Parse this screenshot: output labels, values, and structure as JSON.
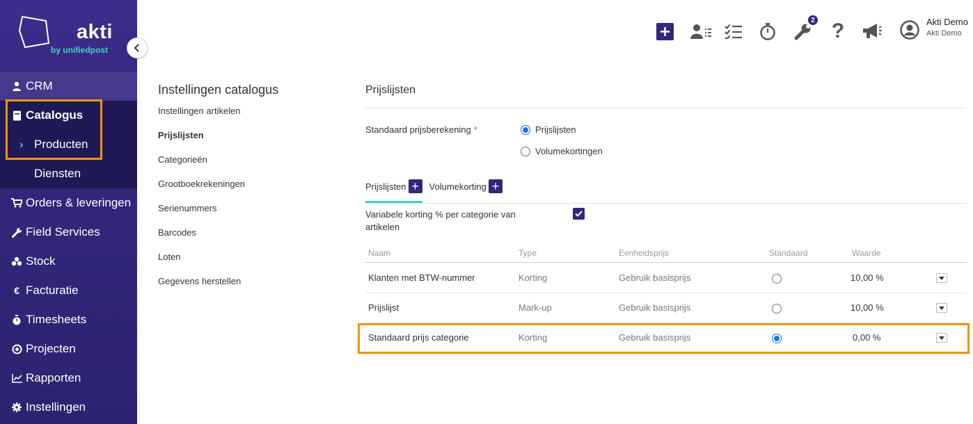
{
  "sidebar": {
    "brand": "akti",
    "brand_sub": "by unifiedpost",
    "items": [
      {
        "label": "CRM",
        "icon": "user-icon"
      },
      {
        "label": "Catalogus",
        "icon": "book-icon"
      },
      {
        "label": "Orders & leveringen",
        "icon": "cart-icon"
      },
      {
        "label": "Field Services",
        "icon": "wrench-icon"
      },
      {
        "label": "Stock",
        "icon": "boxes-icon"
      },
      {
        "label": "Facturatie",
        "icon": "euro-icon"
      },
      {
        "label": "Timesheets",
        "icon": "stopwatch-icon"
      },
      {
        "label": "Projecten",
        "icon": "target-icon"
      },
      {
        "label": "Rapporten",
        "icon": "chart-icon"
      },
      {
        "label": "Instellingen",
        "icon": "gear-icon"
      }
    ],
    "sub_items": [
      "Producten",
      "Diensten"
    ]
  },
  "topbar": {
    "badge_count": "2",
    "user_name": "Akti Demo",
    "user_company": "Akti Demo"
  },
  "settings": {
    "title": "Instellingen catalogus",
    "menu": [
      "Instellingen artikelen",
      "Prijslijsten",
      "Categorieën",
      "Grootboekrekeningen",
      "Serienummers",
      "Barcodes",
      "Loten",
      "Gegevens herstellen"
    ]
  },
  "main": {
    "title": "Prijslijsten",
    "calc_label": "Standaard prijsberekening",
    "required_mark": "*",
    "options": [
      "Prijslijsten",
      "Volumekortingen"
    ],
    "selected_option": "Prijslijsten",
    "tabs": [
      "Prijslijsten",
      "Volumekorting"
    ],
    "variable_label": "Variabele korting % per categorie van artikelen",
    "variable_checked": true,
    "columns": [
      "Naam",
      "Type",
      "Eenheidsprijs",
      "Standaard",
      "Waarde"
    ],
    "rows": [
      {
        "name": "Klanten met BTW-nummer",
        "type": "Korting",
        "unit": "Gebruik basisprijs",
        "standard": false,
        "value": "10,00 %"
      },
      {
        "name": "Prijslijst",
        "type": "Mark-up",
        "unit": "Gebruik basisprijs",
        "standard": false,
        "value": "10,00 %"
      },
      {
        "name": "Standaard prijs categorie",
        "type": "Korting",
        "unit": "Gebruik basisprijs",
        "standard": true,
        "value": "0,00 %"
      }
    ]
  },
  "colors": {
    "sidebar": "#33277a",
    "accent": "#43d1c6",
    "highlight": "#f0940f",
    "radio": "#1a73e8"
  }
}
